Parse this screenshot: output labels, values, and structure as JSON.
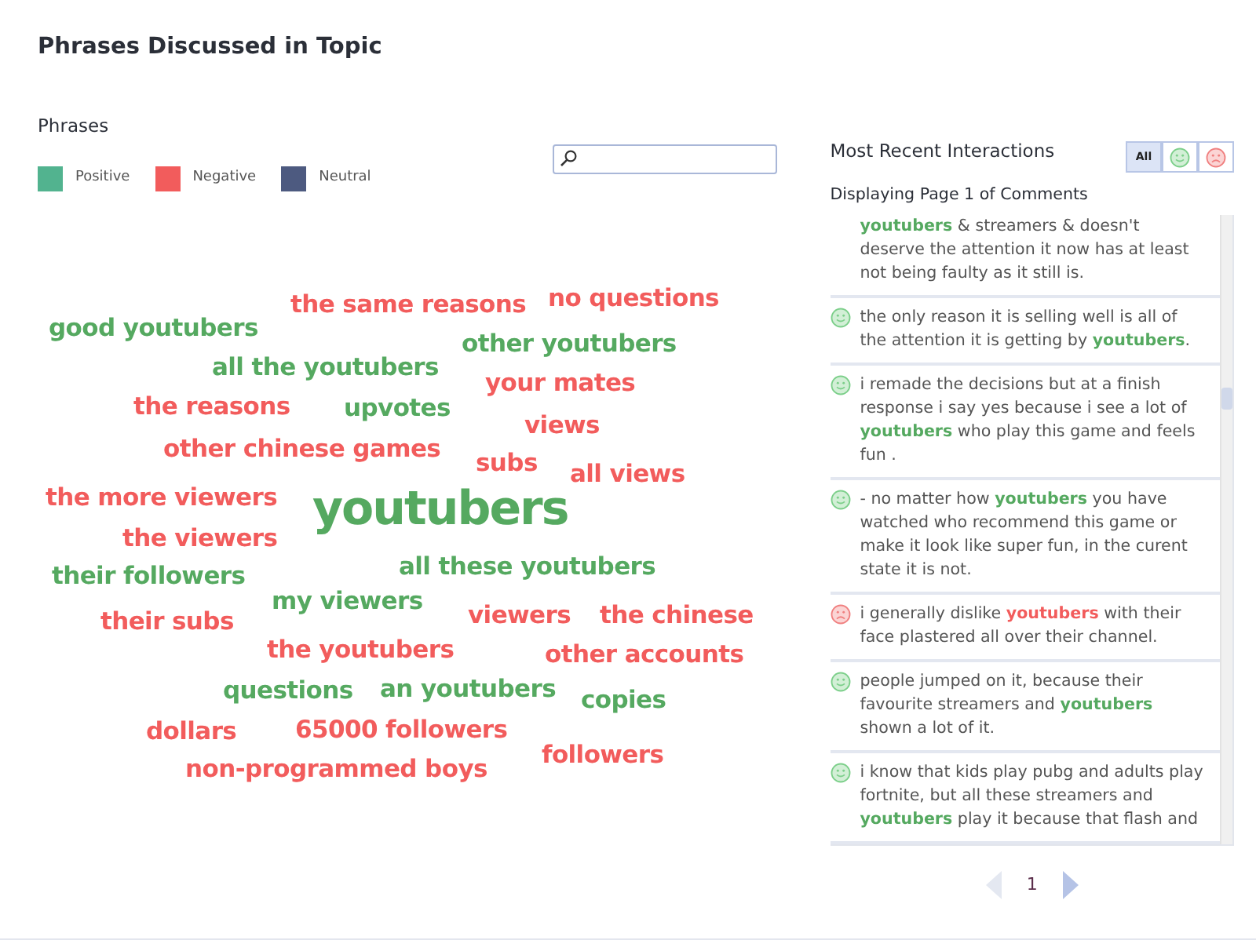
{
  "title": "Phrases Discussed in Topic",
  "phrases": {
    "heading": "Phrases",
    "legend": [
      {
        "label": "Positive",
        "color": "#52b38f"
      },
      {
        "label": "Negative",
        "color": "#f25c5c"
      },
      {
        "label": "Neutral",
        "color": "#4d5a80"
      }
    ],
    "cloud": [
      {
        "text": "the same reasons",
        "color": "#f25c5c"
      },
      {
        "text": "no questions",
        "color": "#f25c5c"
      },
      {
        "text": "good youtubers",
        "color": "#55a960"
      },
      {
        "text": "other youtubers",
        "color": "#55a960"
      },
      {
        "text": "all the youtubers",
        "color": "#55a960"
      },
      {
        "text": "your mates",
        "color": "#f25c5c"
      },
      {
        "text": "the reasons",
        "color": "#f25c5c"
      },
      {
        "text": "upvotes",
        "color": "#55a960"
      },
      {
        "text": "views",
        "color": "#f25c5c"
      },
      {
        "text": "other chinese games",
        "color": "#f25c5c"
      },
      {
        "text": "subs",
        "color": "#f25c5c"
      },
      {
        "text": "all views",
        "color": "#f25c5c"
      },
      {
        "text": "the more viewers",
        "color": "#f25c5c"
      },
      {
        "text": "youtubers",
        "color": "#55a960",
        "kind": "main"
      },
      {
        "text": "the viewers",
        "color": "#f25c5c"
      },
      {
        "text": "their followers",
        "color": "#55a960"
      },
      {
        "text": "all these youtubers",
        "color": "#55a960"
      },
      {
        "text": "my viewers",
        "color": "#55a960"
      },
      {
        "text": "their subs",
        "color": "#f25c5c"
      },
      {
        "text": "viewers",
        "color": "#f25c5c"
      },
      {
        "text": "the chinese",
        "color": "#f25c5c"
      },
      {
        "text": "the youtubers",
        "color": "#f25c5c"
      },
      {
        "text": "other accounts",
        "color": "#f25c5c"
      },
      {
        "text": "questions",
        "color": "#55a960"
      },
      {
        "text": "an youtubers",
        "color": "#55a960"
      },
      {
        "text": "copies",
        "color": "#55a960"
      },
      {
        "text": "dollars",
        "color": "#f25c5c"
      },
      {
        "text": "65000 followers",
        "color": "#f25c5c"
      },
      {
        "text": "non-programmed boys",
        "color": "#f25c5c"
      },
      {
        "text": "followers",
        "color": "#f25c5c"
      }
    ]
  },
  "interactions": {
    "heading": "Most Recent Interactions",
    "filters": [
      {
        "kind": "all",
        "label": "All",
        "selected": true
      },
      {
        "kind": "positive",
        "selected": false
      },
      {
        "kind": "negative",
        "selected": false
      }
    ],
    "subtitle": "Displaying Page 1 of Comments",
    "comments": [
      {
        "kind": "positive",
        "clipped_top": true,
        "text": "**youtubers** & streamers & doesn't deserve the attention it now has at least not being faulty as it still is."
      },
      {
        "kind": "positive",
        "clipped_top": false,
        "text": "the only reason it is selling well is all of the attention it is getting by **youtubers**."
      },
      {
        "kind": "positive",
        "clipped_top": false,
        "text": "i remade the decisions but at a finish response i say yes because i see a lot of **youtubers** who play this game and feels fun ."
      },
      {
        "kind": "positive",
        "clipped_top": false,
        "text": "- no matter how **youtubers** you have watched who recommend this game or make it look like super fun, in the curent state it is not."
      },
      {
        "kind": "negative",
        "clipped_top": false,
        "text": "i generally dislike **youtubers** with their face plastered all over their channel."
      },
      {
        "kind": "positive",
        "clipped_top": false,
        "text": "people jumped on it, because their favourite streamers and **youtubers** shown a lot of it."
      },
      {
        "kind": "positive",
        "clipped_top": false,
        "text": "i know that kids play pubg and adults play fortnite, but all these streamers and **youtubers** play it because that flash and"
      }
    ],
    "pagination": {
      "page": "1",
      "prev_disabled": true,
      "next_disabled": false
    }
  }
}
